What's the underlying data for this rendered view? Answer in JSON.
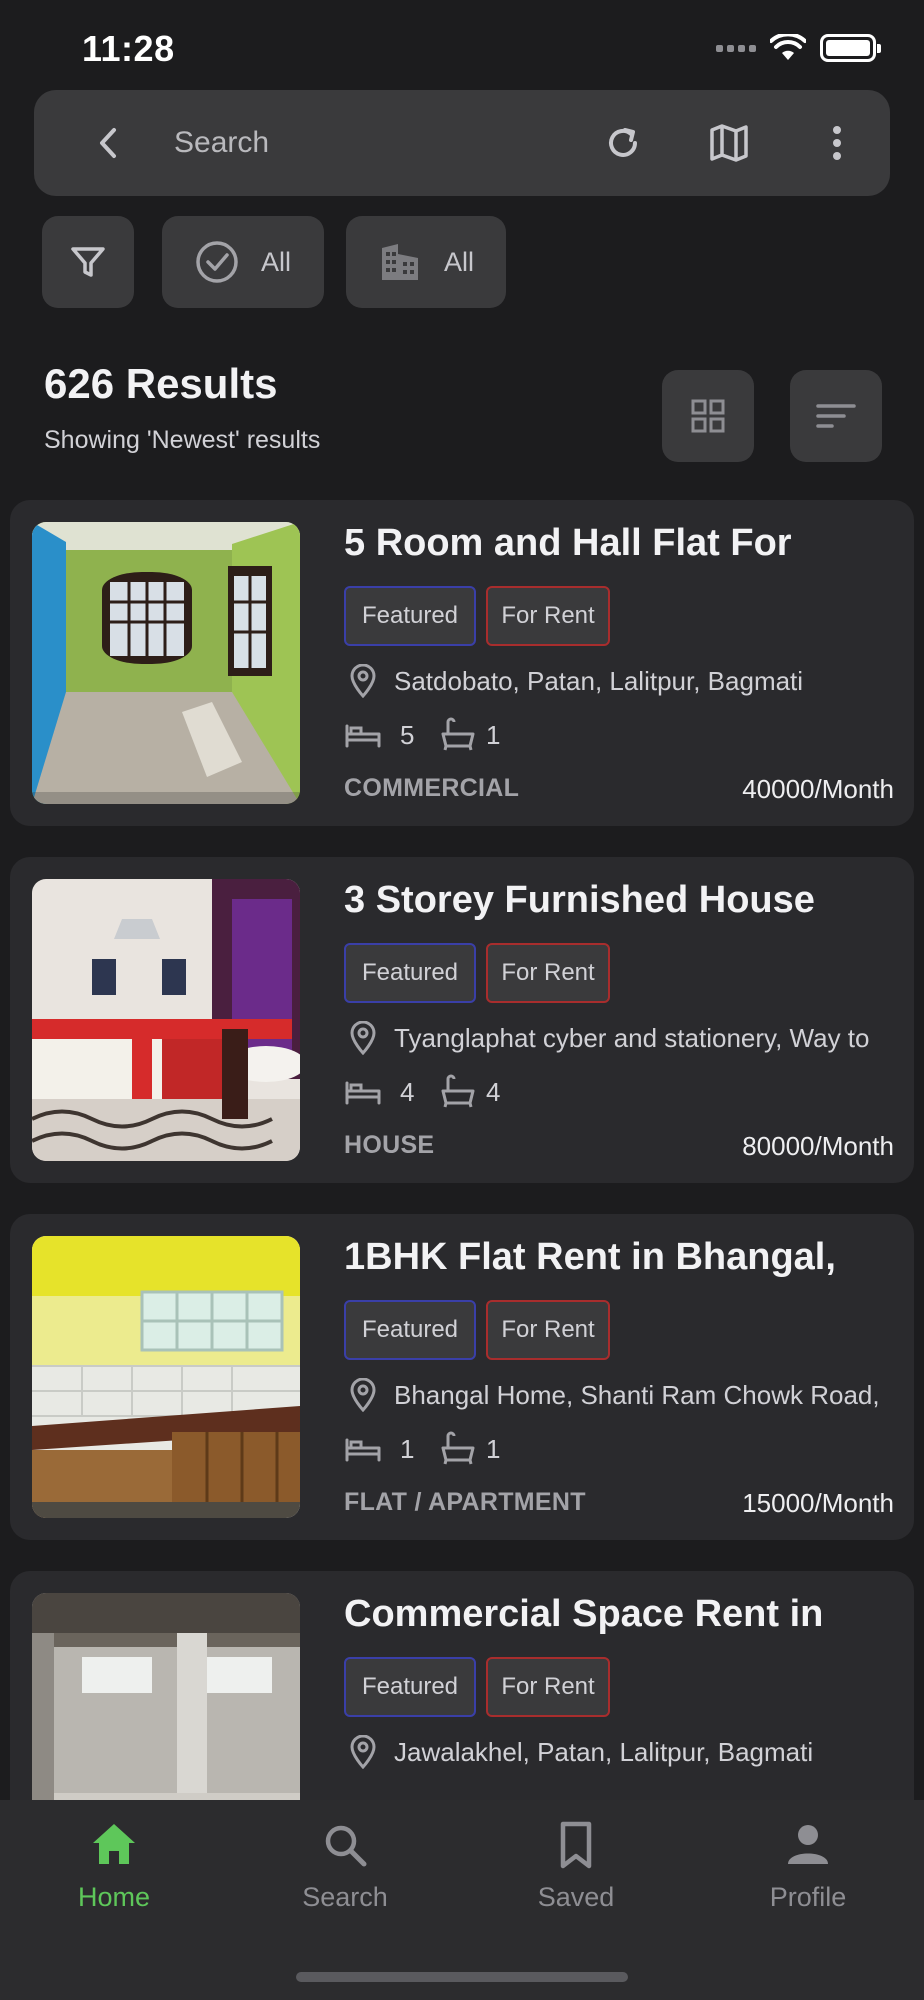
{
  "status_bar": {
    "time": "11:28"
  },
  "search": {
    "placeholder": "Search"
  },
  "filters": {
    "status_label": "All",
    "type_label": "All"
  },
  "results": {
    "count_label": "626 Results",
    "subtitle": "Showing 'Newest' results"
  },
  "listings": [
    {
      "title": "5 Room and Hall Flat For",
      "badge_featured": "Featured",
      "badge_rent": "For Rent",
      "location": "Satdobato, Patan, Lalitpur, Bagmati",
      "beds": "5",
      "baths": "1",
      "property_type": "COMMERCIAL",
      "price": "40000/Month"
    },
    {
      "title": "3 Storey Furnished House",
      "badge_featured": "Featured",
      "badge_rent": "For Rent",
      "location": "Tyanglaphat cyber and stationery, Way to",
      "beds": "4",
      "baths": "4",
      "property_type": "HOUSE",
      "price": "80000/Month"
    },
    {
      "title": "1BHK Flat Rent in Bhangal,",
      "badge_featured": "Featured",
      "badge_rent": "For Rent",
      "location": "Bhangal Home, Shanti Ram Chowk Road,",
      "beds": "1",
      "baths": "1",
      "property_type": "FLAT / APARTMENT",
      "price": "15000/Month"
    },
    {
      "title": "Commercial Space Rent in",
      "badge_featured": "Featured",
      "badge_rent": "For Rent",
      "location": "Jawalakhel, Patan, Lalitpur, Bagmati",
      "beds": "",
      "baths": "",
      "property_type": "",
      "price": ""
    }
  ],
  "bottom_nav": [
    {
      "label": "Home",
      "icon": "home-icon",
      "active": true
    },
    {
      "label": "Search",
      "icon": "search-icon",
      "active": false
    },
    {
      "label": "Saved",
      "icon": "bookmark-icon",
      "active": false
    },
    {
      "label": "Profile",
      "icon": "person-icon",
      "active": false
    }
  ],
  "colors": {
    "background": "#1c1c1e",
    "card": "#2a2a2d",
    "accent_active": "#5ec75a",
    "featured_border": "#3a3fa8",
    "rent_border": "#a82d2d"
  }
}
